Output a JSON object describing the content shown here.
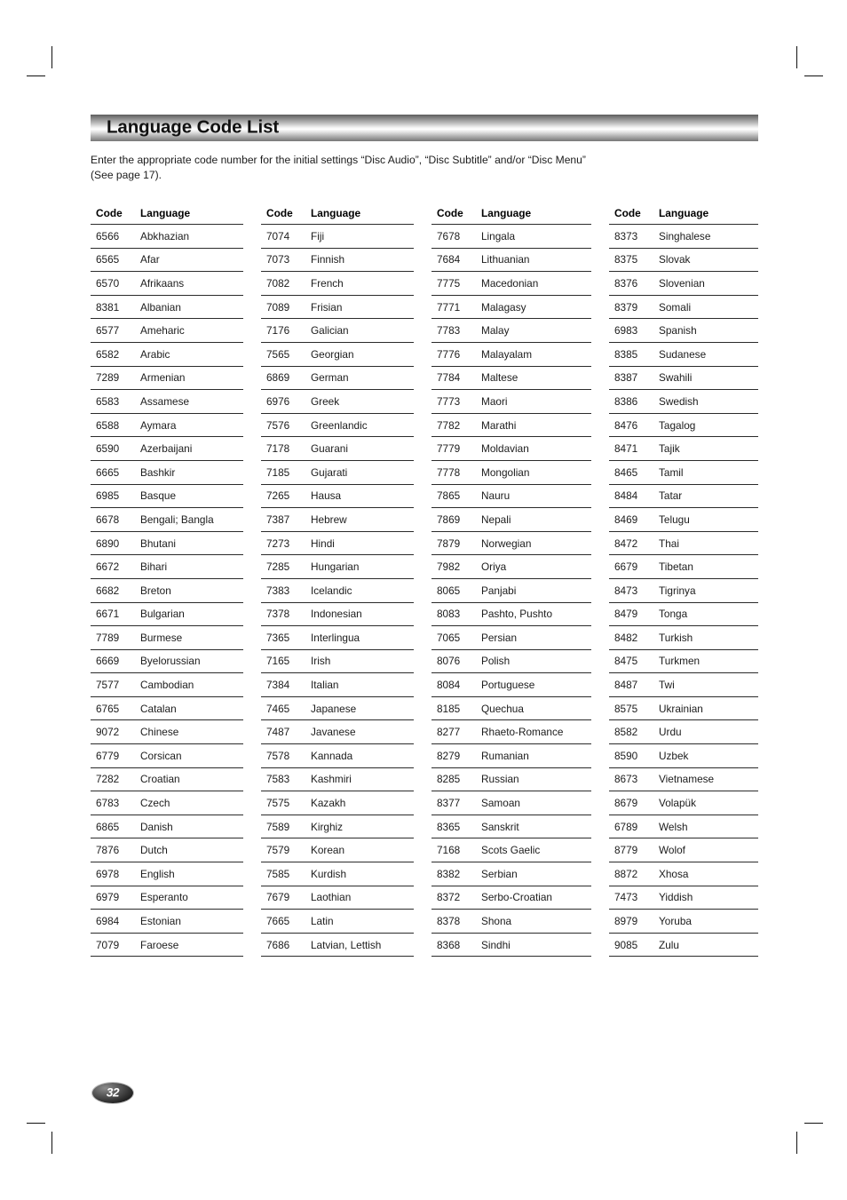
{
  "banner": {
    "title": "Language Code List"
  },
  "intro": {
    "line1": "Enter the appropriate code number for the initial settings “Disc Audio”, “Disc Subtitle” and/or “Disc Menu”",
    "line2": "(See page 17)."
  },
  "table": {
    "headers": {
      "code": "Code",
      "language": "Language"
    },
    "columns": [
      {
        "rows": [
          {
            "code": "6566",
            "language": "Abkhazian"
          },
          {
            "code": "6565",
            "language": "Afar"
          },
          {
            "code": "6570",
            "language": "Afrikaans"
          },
          {
            "code": "8381",
            "language": "Albanian"
          },
          {
            "code": "6577",
            "language": "Ameharic"
          },
          {
            "code": "6582",
            "language": "Arabic"
          },
          {
            "code": "7289",
            "language": "Armenian"
          },
          {
            "code": "6583",
            "language": "Assamese"
          },
          {
            "code": "6588",
            "language": "Aymara"
          },
          {
            "code": "6590",
            "language": "Azerbaijani"
          },
          {
            "code": "6665",
            "language": "Bashkir"
          },
          {
            "code": "6985",
            "language": "Basque"
          },
          {
            "code": "6678",
            "language": "Bengali; Bangla"
          },
          {
            "code": "6890",
            "language": "Bhutani"
          },
          {
            "code": "6672",
            "language": "Bihari"
          },
          {
            "code": "6682",
            "language": "Breton"
          },
          {
            "code": "6671",
            "language": "Bulgarian"
          },
          {
            "code": "7789",
            "language": "Burmese"
          },
          {
            "code": "6669",
            "language": "Byelorussian"
          },
          {
            "code": "7577",
            "language": "Cambodian"
          },
          {
            "code": "6765",
            "language": "Catalan"
          },
          {
            "code": "9072",
            "language": "Chinese"
          },
          {
            "code": "6779",
            "language": "Corsican"
          },
          {
            "code": "7282",
            "language": "Croatian"
          },
          {
            "code": "6783",
            "language": "Czech"
          },
          {
            "code": "6865",
            "language": "Danish"
          },
          {
            "code": "7876",
            "language": "Dutch"
          },
          {
            "code": "6978",
            "language": "English"
          },
          {
            "code": "6979",
            "language": "Esperanto"
          },
          {
            "code": "6984",
            "language": "Estonian"
          },
          {
            "code": "7079",
            "language": "Faroese"
          }
        ]
      },
      {
        "rows": [
          {
            "code": "7074",
            "language": "Fiji"
          },
          {
            "code": "7073",
            "language": "Finnish"
          },
          {
            "code": "7082",
            "language": "French"
          },
          {
            "code": "7089",
            "language": "Frisian"
          },
          {
            "code": "7176",
            "language": "Galician"
          },
          {
            "code": "7565",
            "language": "Georgian"
          },
          {
            "code": "6869",
            "language": "German"
          },
          {
            "code": "6976",
            "language": "Greek"
          },
          {
            "code": "7576",
            "language": "Greenlandic"
          },
          {
            "code": "7178",
            "language": "Guarani"
          },
          {
            "code": "7185",
            "language": "Gujarati"
          },
          {
            "code": "7265",
            "language": "Hausa"
          },
          {
            "code": "7387",
            "language": "Hebrew"
          },
          {
            "code": "7273",
            "language": "Hindi"
          },
          {
            "code": "7285",
            "language": "Hungarian"
          },
          {
            "code": "7383",
            "language": "Icelandic"
          },
          {
            "code": "7378",
            "language": "Indonesian"
          },
          {
            "code": "7365",
            "language": "Interlingua"
          },
          {
            "code": "7165",
            "language": "Irish"
          },
          {
            "code": "7384",
            "language": "Italian"
          },
          {
            "code": "7465",
            "language": "Japanese"
          },
          {
            "code": "7487",
            "language": "Javanese"
          },
          {
            "code": "7578",
            "language": "Kannada"
          },
          {
            "code": "7583",
            "language": "Kashmiri"
          },
          {
            "code": "7575",
            "language": "Kazakh"
          },
          {
            "code": "7589",
            "language": "Kirghiz"
          },
          {
            "code": "7579",
            "language": "Korean"
          },
          {
            "code": "7585",
            "language": "Kurdish"
          },
          {
            "code": "7679",
            "language": "Laothian"
          },
          {
            "code": "7665",
            "language": "Latin"
          },
          {
            "code": "7686",
            "language": "Latvian, Lettish"
          }
        ]
      },
      {
        "rows": [
          {
            "code": "7678",
            "language": "Lingala"
          },
          {
            "code": "7684",
            "language": "Lithuanian"
          },
          {
            "code": "7775",
            "language": "Macedonian"
          },
          {
            "code": "7771",
            "language": "Malagasy"
          },
          {
            "code": "7783",
            "language": "Malay"
          },
          {
            "code": "7776",
            "language": "Malayalam"
          },
          {
            "code": "7784",
            "language": "Maltese"
          },
          {
            "code": "7773",
            "language": "Maori"
          },
          {
            "code": "7782",
            "language": "Marathi"
          },
          {
            "code": "7779",
            "language": "Moldavian"
          },
          {
            "code": "7778",
            "language": "Mongolian"
          },
          {
            "code": "7865",
            "language": "Nauru"
          },
          {
            "code": "7869",
            "language": "Nepali"
          },
          {
            "code": "7879",
            "language": "Norwegian"
          },
          {
            "code": "7982",
            "language": "Oriya"
          },
          {
            "code": "8065",
            "language": "Panjabi"
          },
          {
            "code": "8083",
            "language": "Pashto, Pushto"
          },
          {
            "code": "7065",
            "language": "Persian"
          },
          {
            "code": "8076",
            "language": "Polish"
          },
          {
            "code": "8084",
            "language": "Portuguese"
          },
          {
            "code": "8185",
            "language": "Quechua"
          },
          {
            "code": "8277",
            "language": "Rhaeto-Romance"
          },
          {
            "code": "8279",
            "language": "Rumanian"
          },
          {
            "code": "8285",
            "language": "Russian"
          },
          {
            "code": "8377",
            "language": "Samoan"
          },
          {
            "code": "8365",
            "language": "Sanskrit"
          },
          {
            "code": "7168",
            "language": "Scots Gaelic"
          },
          {
            "code": "8382",
            "language": "Serbian"
          },
          {
            "code": "8372",
            "language": "Serbo-Croatian"
          },
          {
            "code": "8378",
            "language": "Shona"
          },
          {
            "code": "8368",
            "language": "Sindhi"
          }
        ]
      },
      {
        "rows": [
          {
            "code": "8373",
            "language": "Singhalese"
          },
          {
            "code": "8375",
            "language": "Slovak"
          },
          {
            "code": "8376",
            "language": "Slovenian"
          },
          {
            "code": "8379",
            "language": "Somali"
          },
          {
            "code": "6983",
            "language": "Spanish"
          },
          {
            "code": "8385",
            "language": "Sudanese"
          },
          {
            "code": "8387",
            "language": "Swahili"
          },
          {
            "code": "8386",
            "language": "Swedish"
          },
          {
            "code": "8476",
            "language": "Tagalog"
          },
          {
            "code": "8471",
            "language": "Tajik"
          },
          {
            "code": "8465",
            "language": "Tamil"
          },
          {
            "code": "8484",
            "language": "Tatar"
          },
          {
            "code": "8469",
            "language": "Telugu"
          },
          {
            "code": "8472",
            "language": "Thai"
          },
          {
            "code": "6679",
            "language": "Tibetan"
          },
          {
            "code": "8473",
            "language": "Tigrinya"
          },
          {
            "code": "8479",
            "language": "Tonga"
          },
          {
            "code": "8482",
            "language": "Turkish"
          },
          {
            "code": "8475",
            "language": "Turkmen"
          },
          {
            "code": "8487",
            "language": "Twi"
          },
          {
            "code": "8575",
            "language": "Ukrainian"
          },
          {
            "code": "8582",
            "language": "Urdu"
          },
          {
            "code": "8590",
            "language": "Uzbek"
          },
          {
            "code": "8673",
            "language": "Vietnamese"
          },
          {
            "code": "8679",
            "language": "Volapük"
          },
          {
            "code": "6789",
            "language": "Welsh"
          },
          {
            "code": "8779",
            "language": "Wolof"
          },
          {
            "code": "8872",
            "language": "Xhosa"
          },
          {
            "code": "7473",
            "language": "Yiddish"
          },
          {
            "code": "8979",
            "language": "Yoruba"
          },
          {
            "code": "9085",
            "language": "Zulu"
          }
        ]
      }
    ]
  },
  "footer": {
    "page_number": "32"
  }
}
